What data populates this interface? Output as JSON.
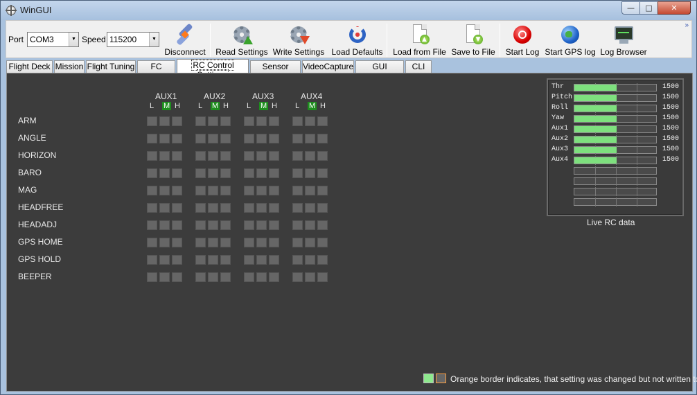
{
  "window": {
    "title": "WinGUI",
    "minimize": "—",
    "maximize": "□",
    "close": "✕"
  },
  "toolbar": {
    "port_label": "Port",
    "port_value": "COM3",
    "speed_label": "Speed",
    "speed_value": "115200",
    "dropdown_arrow": "▼",
    "overflow": "»",
    "buttons": [
      {
        "label": "Disconnect",
        "icon": "plug-icon"
      },
      {
        "label": "Read Settings",
        "icon": "gear-read-icon"
      },
      {
        "label": "Write Settings",
        "icon": "gear-write-icon"
      },
      {
        "label": "Load Defaults",
        "icon": "reload-icon"
      },
      {
        "label": "Load from File",
        "icon": "file-open-icon"
      },
      {
        "label": "Save to File",
        "icon": "file-save-icon"
      },
      {
        "label": "Start Log",
        "icon": "record-icon"
      },
      {
        "label": "Start GPS log",
        "icon": "globe-icon"
      },
      {
        "label": "Log Browser",
        "icon": "monitor-icon"
      }
    ]
  },
  "tabs": [
    {
      "label": "Flight Deck"
    },
    {
      "label": "Mission"
    },
    {
      "label": "Flight Tuning"
    },
    {
      "label": "FC Config"
    },
    {
      "label": "RC Control Settings",
      "active": true
    },
    {
      "label": "Sensor Graph"
    },
    {
      "label": "VideoCapture"
    },
    {
      "label": "GUI Settings"
    },
    {
      "label": "CLI"
    }
  ],
  "rc_settings": {
    "aux_channels": [
      "AUX1",
      "AUX2",
      "AUX3",
      "AUX4"
    ],
    "positions": [
      "L",
      "M",
      "H"
    ],
    "modes": [
      "ARM",
      "ANGLE",
      "HORIZON",
      "BARO",
      "MAG",
      "HEADFREE",
      "HEADADJ",
      "GPS HOME",
      "GPS HOLD",
      "BEEPER"
    ]
  },
  "live_rc": {
    "caption": "Live RC data",
    "channels": [
      {
        "name": "Thr",
        "value": "1500",
        "fill": 0.5
      },
      {
        "name": "Pitch",
        "value": "1500",
        "fill": 0.5
      },
      {
        "name": "Roll",
        "value": "1500",
        "fill": 0.5
      },
      {
        "name": "Yaw",
        "value": "1500",
        "fill": 0.5
      },
      {
        "name": "Aux1",
        "value": "1500",
        "fill": 0.5
      },
      {
        "name": "Aux2",
        "value": "1500",
        "fill": 0.5
      },
      {
        "name": "Aux3",
        "value": "1500",
        "fill": 0.5
      },
      {
        "name": "Aux4",
        "value": "1500",
        "fill": 0.5
      }
    ],
    "empty_bars": 4
  },
  "legend": {
    "text": "Orange border indicates, that setting was changed but not written to FC",
    "active_color": "#8ee88e",
    "changed_color": "#ffa040"
  }
}
